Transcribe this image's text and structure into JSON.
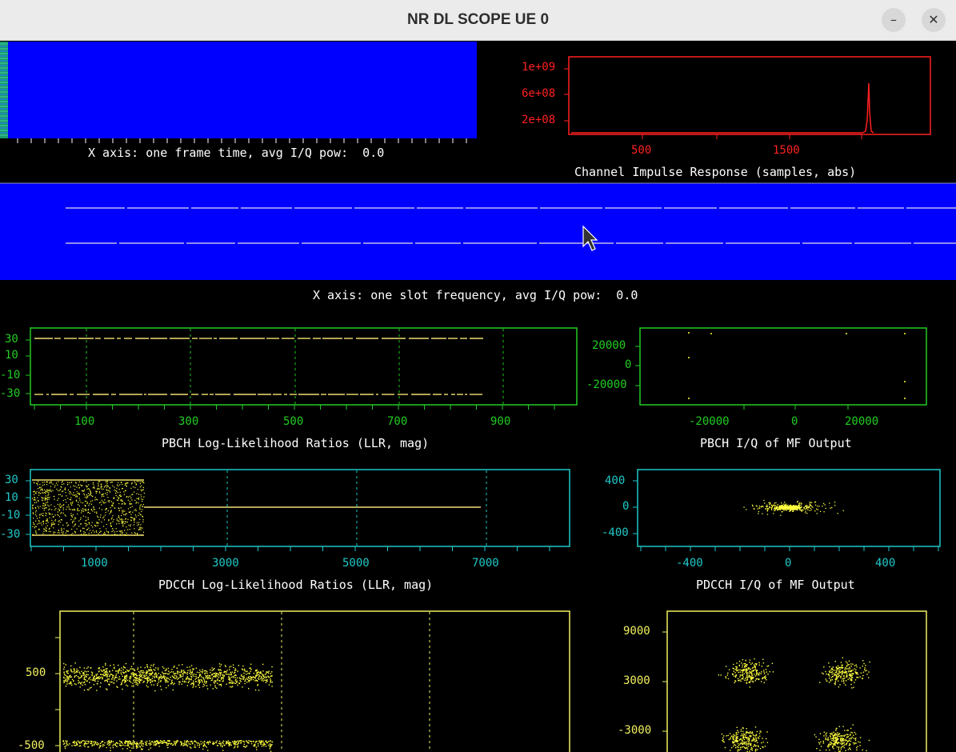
{
  "window": {
    "title": "NR DL SCOPE UE 0",
    "minimize_icon": "minimize-icon",
    "close_icon": "close-icon"
  },
  "colors": {
    "background": "#000000",
    "waterfall_blue": "#0000ff",
    "cir": "#ff2020",
    "pbch": "#22cc22",
    "pdcch": "#20c8c8",
    "pdsch": "#f0f060",
    "points": "#ffff40"
  },
  "time_waterfall": {
    "caption": "X axis: one frame time, avg I/Q pow:  0.0"
  },
  "freq_waterfall": {
    "caption": "X axis: one slot frequency, avg I/Q pow:  0.0"
  },
  "cir": {
    "y_ticks": [
      "1e+09",
      "6e+08",
      "2e+08"
    ],
    "x_ticks": [
      "500",
      "1500"
    ],
    "caption": "Channel Impulse Response (samples, abs)"
  },
  "pbch_llr": {
    "y_ticks": [
      "30",
      "10",
      "-10",
      "-30"
    ],
    "x_ticks": [
      "100",
      "300",
      "500",
      "700",
      "900"
    ],
    "caption": "PBCH Log-Likelihood Ratios (LLR, mag)"
  },
  "pbch_iq": {
    "y_ticks": [
      "20000",
      "0",
      "-20000"
    ],
    "x_ticks": [
      "-20000",
      "0",
      "20000"
    ],
    "caption": "PBCH I/Q of MF Output"
  },
  "pdcch_llr": {
    "y_ticks": [
      "30",
      "10",
      "-10",
      "-30"
    ],
    "x_ticks": [
      "1000",
      "3000",
      "5000",
      "7000"
    ],
    "caption": "PDCCH Log-Likelihood Ratios (LLR, mag)"
  },
  "pdcch_iq": {
    "y_ticks": [
      "400",
      "0",
      "-400"
    ],
    "x_ticks": [
      "-400",
      "0",
      "400"
    ],
    "caption": "PDCCH I/Q of MF Output"
  },
  "pdsch_llr": {
    "y_ticks": [
      "500",
      "-500"
    ]
  },
  "pdsch_iq": {
    "y_ticks": [
      "9000",
      "3000",
      "-3000"
    ]
  }
}
